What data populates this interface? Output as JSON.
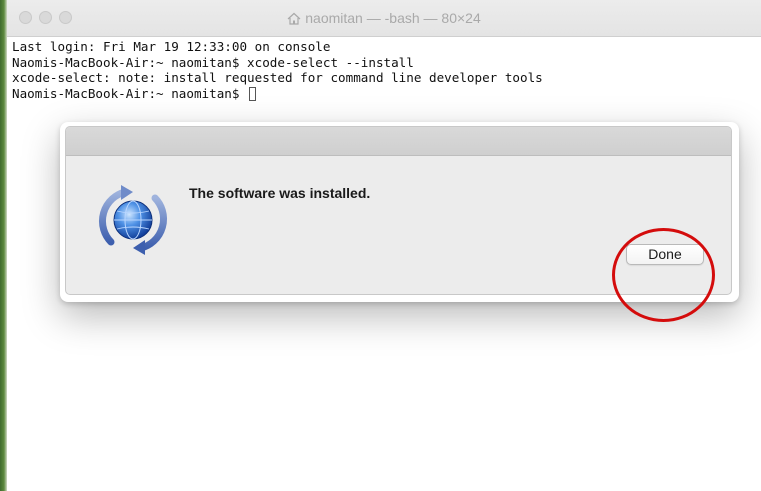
{
  "window": {
    "title": "naomitan — -bash — 80×24",
    "title_icon": "home-icon"
  },
  "terminal": {
    "lines": [
      "Last login: Fri Mar 19 12:33:00 on console",
      "Naomis-MacBook-Air:~ naomitan$ xcode-select --install",
      "xcode-select: note: install requested for command line developer tools",
      "Naomis-MacBook-Air:~ naomitan$ "
    ]
  },
  "dialog": {
    "message": "The software was installed.",
    "icon": "software-update-icon",
    "done_label": "Done"
  },
  "colors": {
    "annotation_circle": "#d40c0c",
    "dialog_background": "#ececec"
  }
}
